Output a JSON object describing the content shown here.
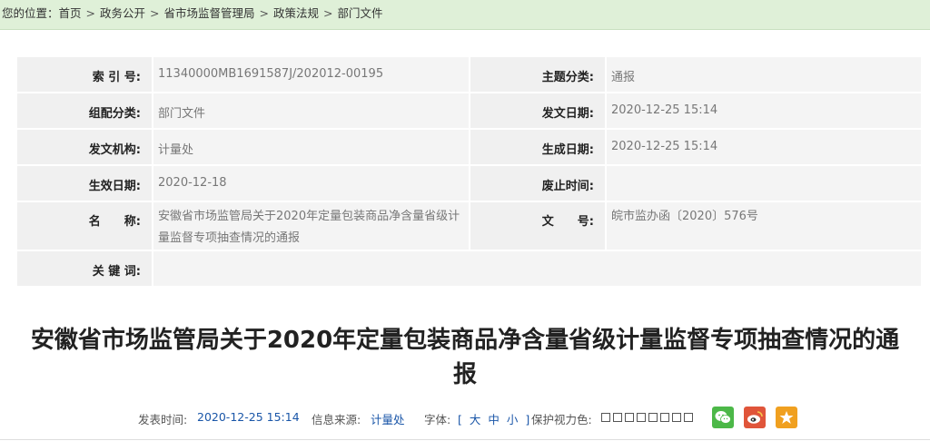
{
  "breadcrumb": {
    "prefix": "您的位置：",
    "items": [
      "首页",
      "政务公开",
      "省市场监督管理局",
      "政策法规",
      "部门文件"
    ],
    "separator": ">"
  },
  "meta": {
    "index_label": "索 引 号:",
    "index_value": "11340000MB1691587J/202012-00195",
    "topic_label": "主题分类:",
    "topic_value": "通报",
    "group_label": "组配分类:",
    "group_value": "部门文件",
    "issue_date_label": "发文日期:",
    "issue_date_value": "2020-12-25 15:14",
    "issuer_label": "发文机构:",
    "issuer_value": "计量处",
    "created_label": "生成日期:",
    "created_value": "2020-12-25 15:14",
    "effective_label": "生效日期:",
    "effective_value": "2020-12-18",
    "abolish_label": "废止时间:",
    "abolish_value": "",
    "name_label": "名　　称:",
    "name_value": "安徽省市场监管局关于2020年定量包装商品净含量省级计量监督专项抽查情况的通报",
    "docno_label": "文　　号:",
    "docno_value": "皖市监办函〔2020〕576号",
    "keywords_label": "关 键 词:",
    "keywords_value": ""
  },
  "title": "安徽省市场监管局关于2020年定量包装商品净含量省级计量监督专项抽查情况的通报",
  "info": {
    "publish_label": "发表时间:",
    "publish_value": "2020-12-25 15:14",
    "source_label": "信息来源:",
    "source_value": "计量处",
    "font_label": "字体:",
    "font_open": "[",
    "font_large": "大",
    "font_medium": "中",
    "font_small": "小",
    "font_close": "]",
    "eye_label": "保护视力色:"
  },
  "icons": {
    "wechat": "wechat-icon",
    "weibo": "weibo-icon",
    "favorite": "star-icon"
  },
  "colors": {
    "breadcrumb_bg": "#dff0d8",
    "link_blue": "#1a56a8",
    "wechat": "#4cb848",
    "weibo": "#e0553a",
    "favorite": "#f0a020"
  }
}
